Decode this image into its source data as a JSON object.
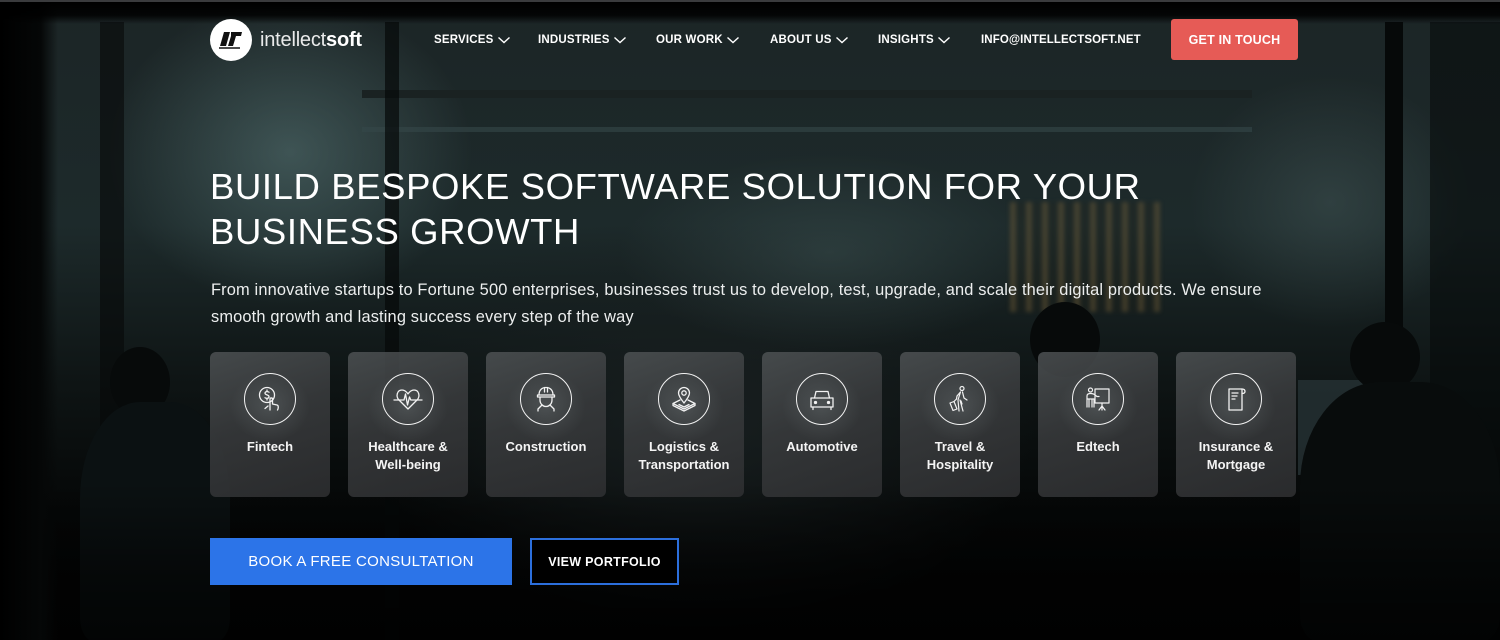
{
  "brand": {
    "name_light": "intellect",
    "name_bold": "soft",
    "logo_icon": "intellectsoft-logo-icon"
  },
  "nav": {
    "items": [
      {
        "label": "SERVICES",
        "icon": "chevron-down-icon"
      },
      {
        "label": "INDUSTRIES",
        "icon": "chevron-down-icon"
      },
      {
        "label": "OUR WORK",
        "icon": "chevron-down-icon"
      },
      {
        "label": "ABOUT US",
        "icon": "chevron-down-icon"
      },
      {
        "label": "INSIGHTS",
        "icon": "chevron-down-icon"
      }
    ],
    "email": "INFO@INTELLECTSOFT.NET",
    "cta_label": "GET IN TOUCH"
  },
  "hero": {
    "title": "BUILD BESPOKE SOFTWARE SOLUTION FOR YOUR BUSINESS GROWTH",
    "subtitle": "From innovative startups to Fortune 500 enterprises, businesses trust us to develop, test, upgrade, and scale their digital products. We ensure smooth growth and lasting success every step of the way"
  },
  "industries": [
    {
      "label": "Fintech",
      "icon": "dollar-coin-hand-icon"
    },
    {
      "label": "Healthcare &\nWell-being",
      "icon": "heart-pulse-icon"
    },
    {
      "label": "Construction",
      "icon": "hard-hat-worker-icon"
    },
    {
      "label": "Logistics &\nTransportation",
      "icon": "map-pin-icon"
    },
    {
      "label": "Automotive",
      "icon": "car-icon"
    },
    {
      "label": "Travel &\nHospitality",
      "icon": "traveler-luggage-icon"
    },
    {
      "label": "Edtech",
      "icon": "teacher-board-icon"
    },
    {
      "label": "Insurance &\nMortgage",
      "icon": "document-scroll-icon"
    }
  ],
  "actions": {
    "primary_label": "BOOK A FREE CONSULTATION",
    "secondary_label": "VIEW PORTFOLIO"
  },
  "colors": {
    "cta_red": "#e65b56",
    "primary_blue": "#2c74e8",
    "outline_blue": "#2c6fdc"
  }
}
